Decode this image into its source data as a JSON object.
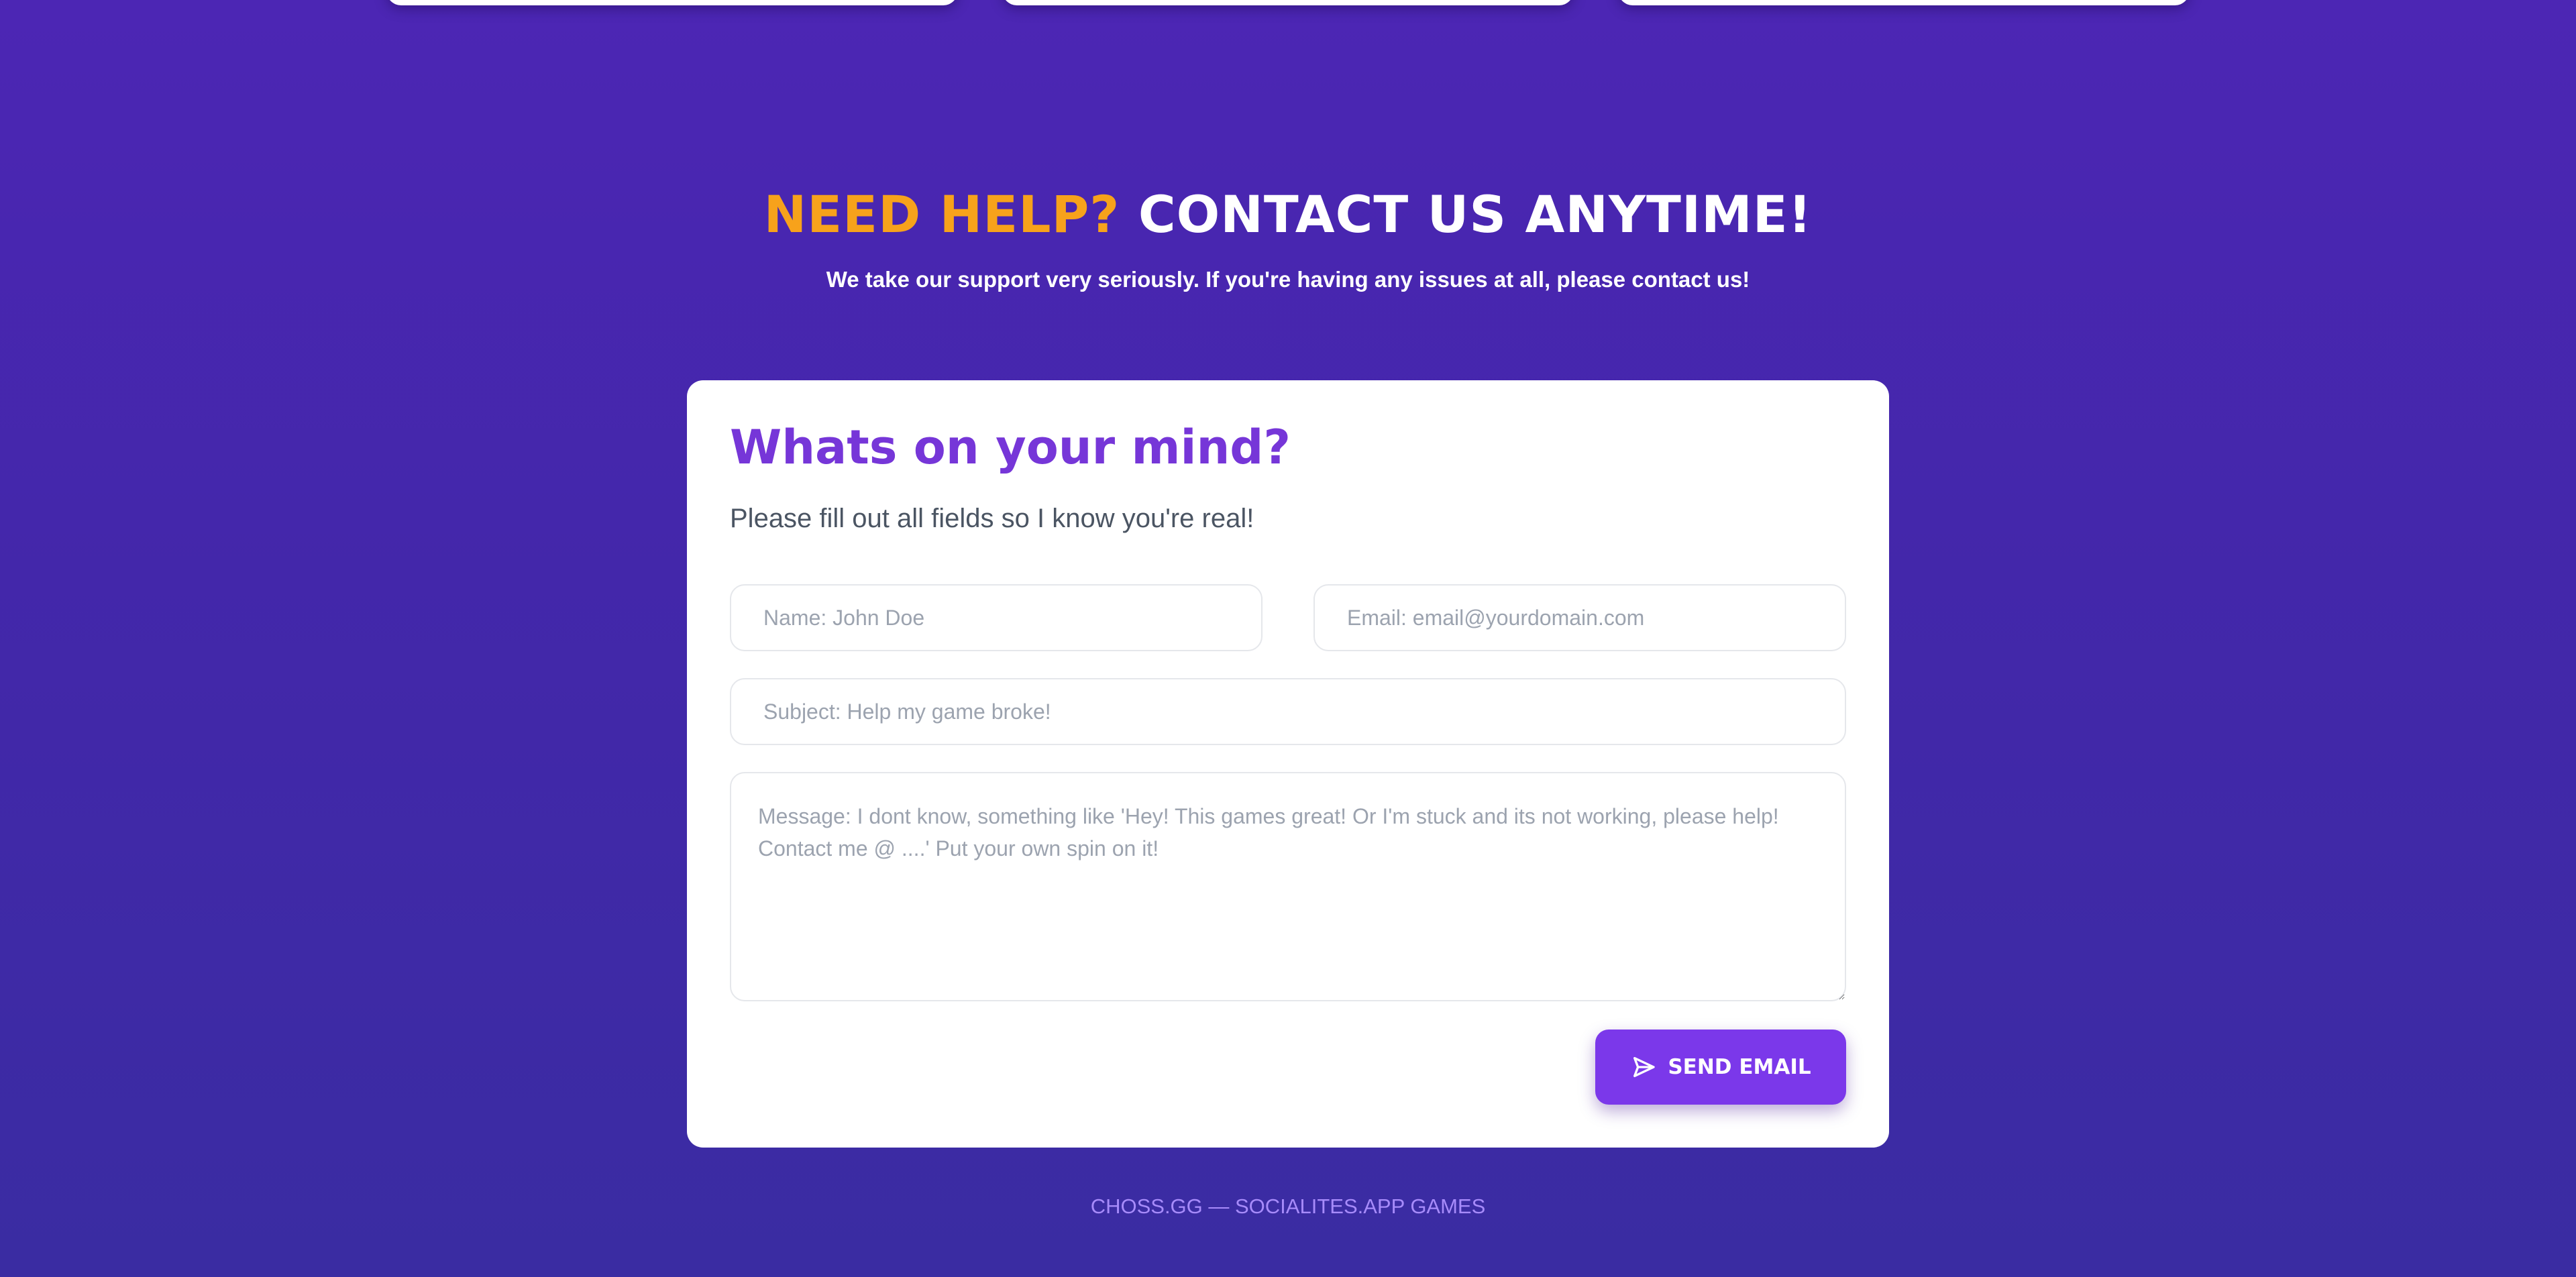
{
  "heading": {
    "highlight": "NEED HELP?",
    "rest": "CONTACT US ANYTIME!"
  },
  "subheading": "We take our support very seriously. If you're having any issues at all, please contact us!",
  "form": {
    "title": "Whats on your mind?",
    "description": "Please fill out all fields so I know you're real!",
    "name_placeholder": "Name: John Doe",
    "email_placeholder": "Email: email@yourdomain.com",
    "subject_placeholder": "Subject: Help my game broke!",
    "message_placeholder": "Message: I dont know, something like 'Hey! This games great! Or I'm stuck and its not working, please help! Contact me @ ....' Put your own spin on it!",
    "send_label": "SEND EMAIL",
    "send_icon": "send-icon"
  },
  "footer": "CHOSS.GG — SOCIALITES.APP GAMES",
  "colors": {
    "accent": "#7b38ea",
    "highlight": "#f7a21b",
    "background_top": "#4c26b4",
    "background_bottom": "#3a2ca2",
    "footer_text": "#a78bfa"
  }
}
